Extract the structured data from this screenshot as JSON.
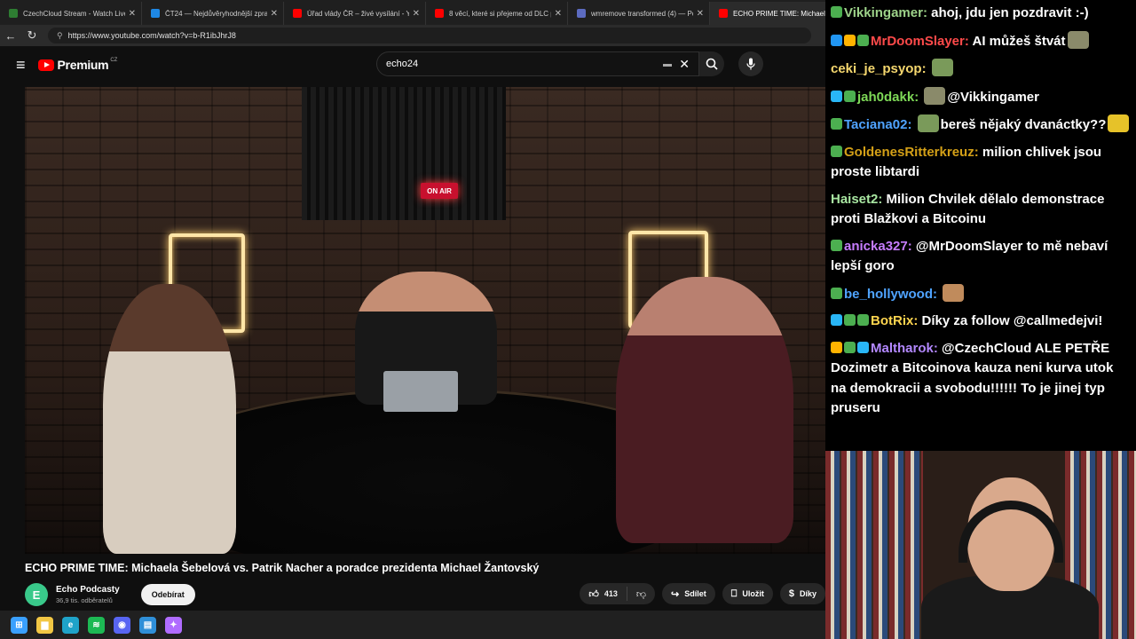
{
  "browser": {
    "tabs": [
      {
        "title": "CzechCloud Stream - Watch Live o",
        "color": "#2e7d32",
        "active": false
      },
      {
        "title": "ČT24 — Nejdůvěryhodnější zpravo",
        "color": "#1e88e5",
        "active": false
      },
      {
        "title": "Úřad vlády ČR – živé vysílání - You",
        "color": "#ff0000",
        "active": false
      },
      {
        "title": "8 věcí, které si přejeme od DLC pro",
        "color": "#ff0000",
        "active": false
      },
      {
        "title": "wmremove transformed (4) — Po",
        "color": "#5c6bc0",
        "active": false
      },
      {
        "title": "ECHO PRIME TIME: Michaela Š",
        "color": "#ff0000",
        "active": true
      }
    ],
    "url": "https://www.youtube.com/watch?v=b-R1ibJhrJ8"
  },
  "youtube": {
    "logo_text": "Premium",
    "logo_region": "CZ",
    "search_value": "echo24",
    "video_title": "ECHO PRIME TIME: Michaela Šebelová vs. Patrik Nacher a poradce prezidenta Michael Žantovský",
    "channel_initial": "E",
    "channel_name": "Echo Podcasty",
    "channel_subs": "36,9 tis. odběratelů",
    "subscribe_label": "Odebírat",
    "like_count": "413",
    "share_label": "Sdílet",
    "save_label": "Uložit",
    "thanks_label": "Díky",
    "on_air_text": "ON AIR"
  },
  "chat": {
    "messages": [
      {
        "badges": [
          "#4caf50"
        ],
        "user": "Vikkingamer",
        "user_color": "#9ed38a",
        "text": "ahoj, jdu jen pozdravit :-)",
        "emotes_before": 0,
        "emotes_after": 0
      },
      {
        "badges": [
          "#2196f3",
          "#ffb300",
          "#4caf50"
        ],
        "user": "MrDoomSlayer",
        "user_color": "#ff4a4a",
        "text": "AI můžeš štvát",
        "emotes_before": 0,
        "emotes_after": 1
      },
      {
        "badges": [],
        "user": "ceki_je_psyop",
        "user_color": "#f5d76e",
        "text": "",
        "emotes_before": 0,
        "emotes_after": 1
      },
      {
        "badges": [
          "#29b6f6",
          "#4caf50"
        ],
        "user": "jah0dakk",
        "user_color": "#7ed957",
        "text": "@Vikkingamer",
        "emotes_before": 1,
        "emotes_after": 0
      },
      {
        "badges": [
          "#4caf50"
        ],
        "user": "Taciana02",
        "user_color": "#4fa3ff",
        "text": "bereš nějaký dvanáctky??",
        "emotes_before": 1,
        "emotes_after": 1
      },
      {
        "badges": [
          "#4caf50"
        ],
        "user": "GoldenesRitterkreuz",
        "user_color": "#d4a017",
        "text": "milion chlivek jsou proste libtardi",
        "emotes_before": 0,
        "emotes_after": 0
      },
      {
        "badges": [],
        "user": "Haiset2",
        "user_color": "#a8e6a1",
        "text": "Milion Chvilek dělalo demonstrace proti Blažkovi a Bitcoinu",
        "emotes_before": 0,
        "emotes_after": 0
      },
      {
        "badges": [
          "#4caf50"
        ],
        "user": "anicka327",
        "user_color": "#c77dff",
        "text": "@MrDoomSlayer to mě nebaví lepší goro",
        "emotes_before": 0,
        "emotes_after": 0
      },
      {
        "badges": [
          "#4caf50"
        ],
        "user": "be_hollywood",
        "user_color": "#4fa3ff",
        "text": "",
        "emotes_before": 0,
        "emotes_after": 1
      },
      {
        "badges": [
          "#29b6f6",
          "#4caf50",
          "#4caf50"
        ],
        "user": "BotRix",
        "user_color": "#ffd54f",
        "text": "Díky za follow @callmedejvi!",
        "emotes_before": 0,
        "emotes_after": 0
      },
      {
        "badges": [
          "#ffb300",
          "#4caf50",
          "#29b6f6"
        ],
        "user": "Maltharok",
        "user_color": "#b388ff",
        "text": "@CzechCloud ALE PETŘE Dozimetr a Bitcoinova kauza neni kurva utok na demokracii a svobodu!!!!!! To je jinej typ pruseru",
        "emotes_before": 0,
        "emotes_after": 0
      }
    ]
  },
  "taskbar": {
    "icons": [
      {
        "name": "windows-start-icon",
        "color": "#3aa0ff",
        "glyph": "⊞"
      },
      {
        "name": "file-explorer-icon",
        "color": "#f2c744",
        "glyph": "▆"
      },
      {
        "name": "edge-browser-icon",
        "color": "#1fa3c9",
        "glyph": "e"
      },
      {
        "name": "spotify-icon",
        "color": "#1db954",
        "glyph": "≋"
      },
      {
        "name": "discord-icon",
        "color": "#5865f2",
        "glyph": "◉"
      },
      {
        "name": "notepad-icon",
        "color": "#2f8fd8",
        "glyph": "▤"
      },
      {
        "name": "copilot-icon",
        "color": "#b06cff",
        "glyph": "✦"
      }
    ]
  }
}
